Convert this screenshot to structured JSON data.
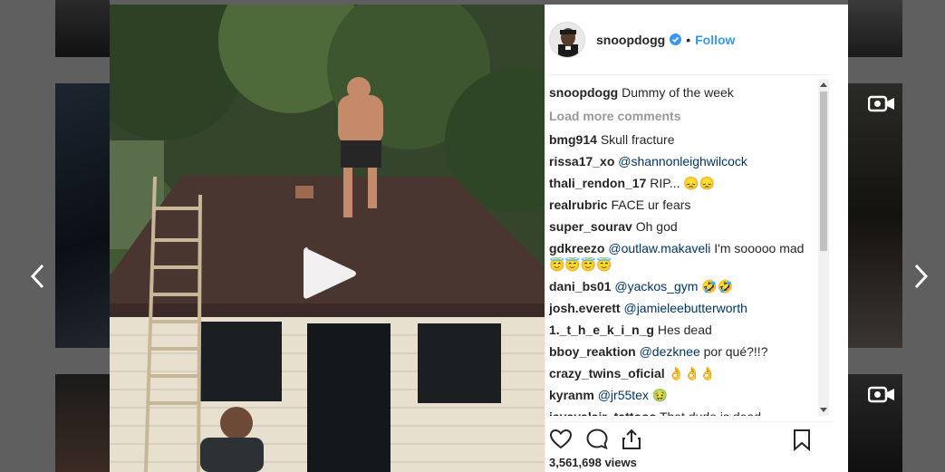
{
  "post": {
    "username": "snoopdogg",
    "follow_label": "Follow",
    "dot": "•",
    "views": "3,561,698 views"
  },
  "caption": {
    "user": "snoopdogg",
    "text": "Dummy of the week"
  },
  "load_more": "Load more comments",
  "comments": [
    {
      "user": "bmg914",
      "mention": "",
      "text": "Skull fracture"
    },
    {
      "user": "rissa17_xo",
      "mention": "@shannonleighwilcock",
      "text": ""
    },
    {
      "user": "thali_rendon_17",
      "mention": "",
      "text": "RIP... 😞😞"
    },
    {
      "user": "realrubric",
      "mention": "",
      "text": "FACE ur fears"
    },
    {
      "user": "super_sourav",
      "mention": "",
      "text": "Oh god"
    },
    {
      "user": "gdkreezo",
      "mention": "@outlaw.makaveli",
      "text": "I'm sooooo mad 😇😇😇😇"
    },
    {
      "user": "dani_bs01",
      "mention": "@yackos_gym",
      "text": "🤣🤣"
    },
    {
      "user": "josh.everett",
      "mention": "@jamieleebutterworth",
      "text": ""
    },
    {
      "user": "1._t_h_e_k_i_n_g",
      "mention": "",
      "text": "Hes dead"
    },
    {
      "user": "bboy_reaktion",
      "mention": "@dezknee",
      "text": "por qué?!!?"
    },
    {
      "user": "crazy_twins_oficial",
      "mention": "",
      "text": "👌👌👌"
    },
    {
      "user": "kyranm",
      "mention": "@jr55tex",
      "text": "🤢"
    },
    {
      "user": "jayayalajr_tattoos",
      "mention": "",
      "text": "That dude is dead"
    }
  ],
  "icons": {
    "like": "heart-icon",
    "comment": "comment-icon",
    "share": "share-icon",
    "save": "bookmark-icon",
    "play": "play-icon",
    "prev": "chevron-left-icon",
    "next": "chevron-right-icon",
    "verified": "verified-badge-icon"
  },
  "colors": {
    "link": "#3897f0",
    "mention": "#003569",
    "muted": "#999999",
    "text": "#262626"
  }
}
